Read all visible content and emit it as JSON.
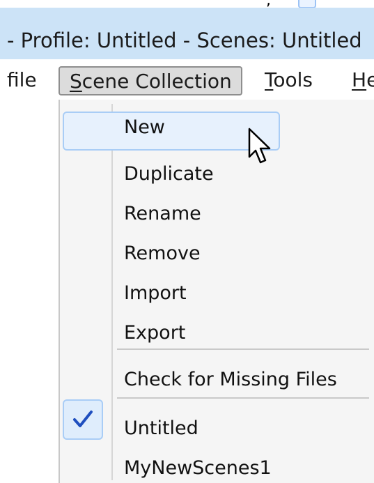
{
  "title_bar": {
    "text": "- Profile: Untitled - Scenes: Untitled"
  },
  "menu_bar": {
    "profile": "file",
    "scene_collection_mnemonic": "S",
    "scene_collection_rest": "cene Collection",
    "tools_mnemonic": "T",
    "tools_rest": "ools",
    "help_mnemonic": "H",
    "help_rest": "e"
  },
  "dropdown": {
    "items": [
      {
        "label": "New"
      },
      {
        "label": "Duplicate"
      },
      {
        "label": "Rename"
      },
      {
        "label": "Remove"
      },
      {
        "label": "Import"
      },
      {
        "label": "Export"
      },
      {
        "label": "Check for Missing Files"
      },
      {
        "label": "Untitled"
      },
      {
        "label": "MyNewScenes1"
      }
    ],
    "highlighted": "New",
    "checked": "Untitled"
  },
  "colors": {
    "title_bar_bg": "#cce3f7",
    "highlight_border": "#a9cdf6",
    "check_color": "#1f4fbf"
  },
  "icons": {
    "check": "checkmark-icon",
    "cursor": "mouse-pointer-icon"
  }
}
